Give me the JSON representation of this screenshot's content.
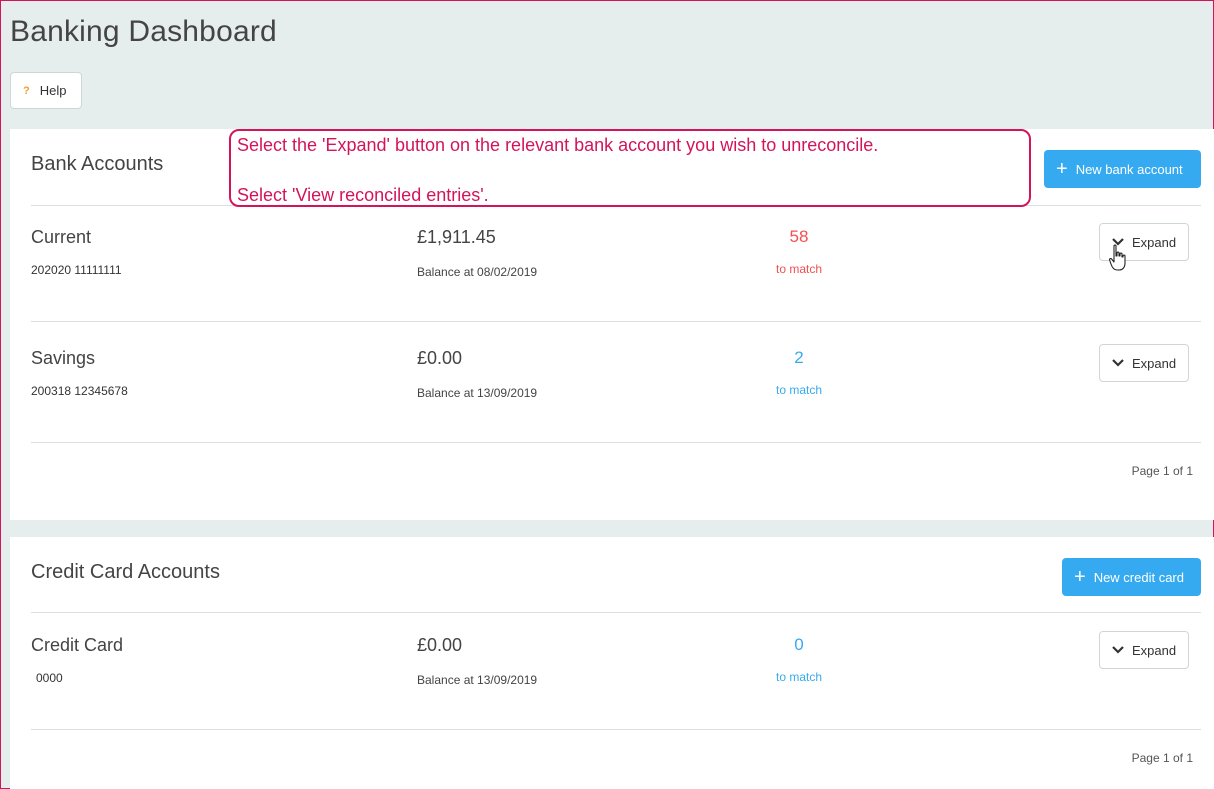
{
  "page": {
    "title": "Banking Dashboard",
    "help_label": "Help",
    "help_icon": "?"
  },
  "callout": {
    "line1": "Select the 'Expand' button on the relevant bank account you wish to unreconcile.",
    "line2": "Select 'View reconciled entries'."
  },
  "bank_accounts": {
    "title": "Bank Accounts",
    "new_button_label": "New bank account",
    "pager": "Page 1 of 1",
    "rows": [
      {
        "name": "Current",
        "number": "202020 11111111",
        "amount": "£1,911.45",
        "balance": "Balance at 08/02/2019",
        "match_count": "58",
        "match_label": "to match",
        "match_color": "#f25050",
        "expand_label": "Expand"
      },
      {
        "name": "Savings",
        "number": "200318 12345678",
        "amount": "£0.00",
        "balance": "Balance at 13/09/2019",
        "match_count": "2",
        "match_label": "to match",
        "match_color": "#36aaf0",
        "expand_label": "Expand"
      }
    ]
  },
  "credit_accounts": {
    "title": "Credit Card Accounts",
    "new_button_label": "New credit card",
    "pager": "Page 1 of 1",
    "rows": [
      {
        "name": "Credit Card",
        "number": "0000",
        "amount": "£0.00",
        "balance": "Balance at 13/09/2019",
        "match_count": "0",
        "match_label": "to match",
        "match_color": "#36aaf0",
        "expand_label": "Expand"
      }
    ]
  },
  "colors": {
    "accent": "#36aaf0",
    "alert": "#f25050",
    "annotation": "#d4145a",
    "background": "#e6eeed"
  },
  "icons": {
    "help": "question-icon",
    "add": "plus-icon",
    "expand": "chevron-down-icon",
    "pointer": "hand-pointer-icon"
  }
}
